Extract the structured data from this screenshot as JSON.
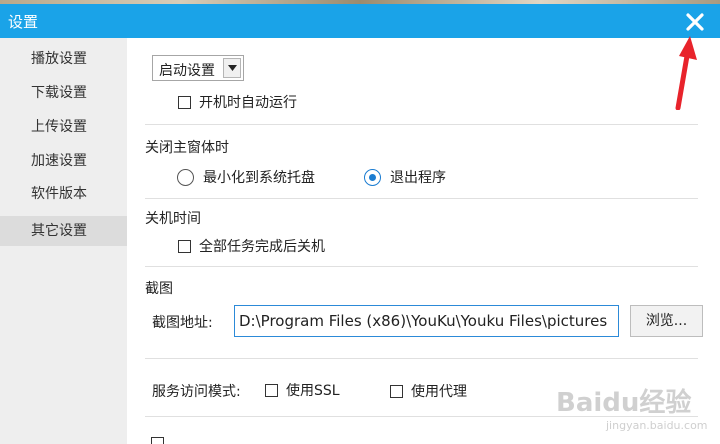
{
  "window": {
    "title": "设置"
  },
  "sidebar": {
    "items": [
      {
        "label": "播放设置"
      },
      {
        "label": "下载设置"
      },
      {
        "label": "上传设置"
      },
      {
        "label": "加速设置"
      },
      {
        "label": "软件版本"
      },
      {
        "label": "其它设置",
        "active": true
      }
    ]
  },
  "startup": {
    "select_value": "启动设置",
    "autorun_label": "开机时自动运行",
    "autorun_checked": false
  },
  "close_main": {
    "heading": "关闭主窗体时",
    "option_minimize": "最小化到系统托盘",
    "option_exit": "退出程序",
    "selected": "exit"
  },
  "shutdown": {
    "heading": "关机时间",
    "after_tasks_label": "全部任务完成后关机",
    "checked": false
  },
  "screenshot": {
    "heading": "截图",
    "path_label": "截图地址:",
    "path_value": "D:\\Program Files (x86)\\YouKu\\Youku Files\\pictures",
    "browse_label": "浏览..."
  },
  "service": {
    "label": "服务访问模式:",
    "ssl_label": "使用SSL",
    "ssl_checked": false,
    "proxy_label": "使用代理",
    "proxy_checked": false
  },
  "watermark": {
    "brand": "Baidu经验",
    "url": "jingyan.baidu.com"
  },
  "colors": {
    "accent": "#1aa3e8",
    "annotation_red": "#e8232b"
  }
}
